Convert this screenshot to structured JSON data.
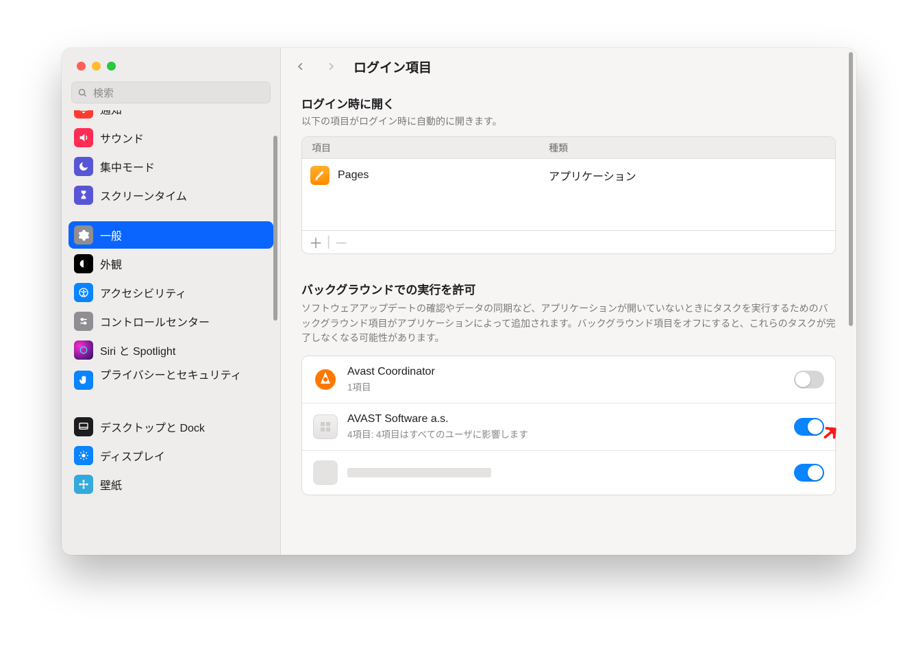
{
  "search": {
    "placeholder": "検索"
  },
  "sidebar": {
    "items": [
      {
        "label": "通知"
      },
      {
        "label": "サウンド"
      },
      {
        "label": "集中モード"
      },
      {
        "label": "スクリーンタイム"
      },
      {
        "label": "一般"
      },
      {
        "label": "外観"
      },
      {
        "label": "アクセシビリティ"
      },
      {
        "label": "コントロールセンター"
      },
      {
        "label": "Siri と Spotlight"
      },
      {
        "label": "プライバシーとセキュリティ"
      },
      {
        "label": "デスクトップと Dock"
      },
      {
        "label": "ディスプレイ"
      },
      {
        "label": "壁紙"
      }
    ]
  },
  "header": {
    "title": "ログイン項目"
  },
  "openAtLogin": {
    "title": "ログイン時に開く",
    "subtitle": "以下の項目がログイン時に自動的に開きます。",
    "columns": {
      "item": "項目",
      "kind": "種類"
    },
    "rows": [
      {
        "name": "Pages",
        "kind": "アプリケーション"
      }
    ],
    "add": "＋",
    "remove": "－"
  },
  "background": {
    "title": "バックグラウンドでの実行を許可",
    "desc": "ソフトウェアアップデートの確認やデータの同期など、アプリケーションが開いていないときにタスクを実行するためのバックグラウンド項目がアプリケーションによって追加されます。バックグラウンド項目をオフにすると、これらのタスクが完了しなくなる可能性があります。",
    "items": [
      {
        "name": "Avast Coordinator",
        "sub": "1項目",
        "on": false,
        "iconName": "avast-icon"
      },
      {
        "name": "AVAST Software a.s.",
        "sub": "4項目: 4項目はすべてのユーザに影響します",
        "on": true,
        "iconName": "generic-app-icon"
      },
      {
        "name": "",
        "sub": "",
        "on": true,
        "iconName": "generic-app-icon"
      }
    ]
  }
}
